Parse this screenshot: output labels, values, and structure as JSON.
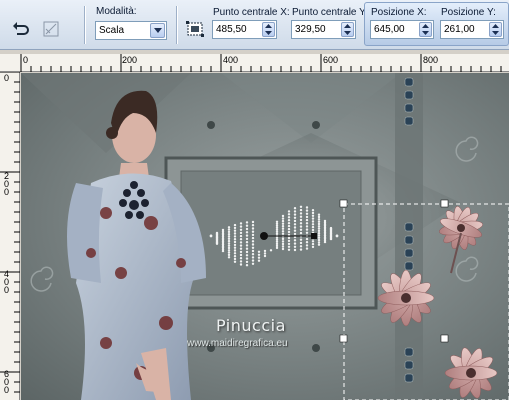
{
  "toolbar": {
    "mode_label": "Modalità:",
    "mode_value": "Scala",
    "center_x_label": "Punto centrale X:",
    "center_x_value": "485,50",
    "center_y_label": "Punto centrale Y:",
    "center_y_value": "329,50",
    "pos_x_label": "Posizione X:",
    "pos_x_value": "645,00",
    "pos_y_label": "Posizione Y:",
    "pos_y_value": "261,00"
  },
  "ruler": {
    "h_labels": [
      "0",
      "200",
      "400",
      "600",
      "800"
    ],
    "v_labels": [
      "0",
      "2\n0\n0",
      "4\n0\n0",
      "6\n0\n0"
    ]
  },
  "canvas": {
    "watermark_name": "Pinuccia",
    "watermark_url": "www.maidiregrafica.eu"
  },
  "colors": {
    "toolbar_bg": "#cfdbe9",
    "canvas_bg": "#788181",
    "selection": "#ffffff"
  }
}
